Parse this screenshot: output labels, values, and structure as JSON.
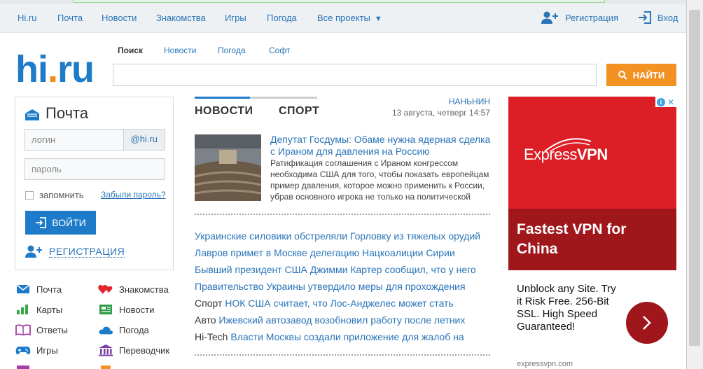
{
  "topnav": {
    "items": [
      "Hi.ru",
      "Почта",
      "Новости",
      "Знакомства",
      "Игры",
      "Погода",
      "Все проекты"
    ],
    "register": "Регистрация",
    "login": "Вход"
  },
  "logo": {
    "part1": "hi",
    "dot": ".",
    "part2": "ru"
  },
  "search": {
    "tabs": [
      "Поиск",
      "Новости",
      "Погода",
      "Софт"
    ],
    "button": "НАЙТИ",
    "placeholder": ""
  },
  "mail": {
    "title": "Почта",
    "login_placeholder": "логин",
    "domain": "@hi.ru",
    "password_placeholder": "пароль",
    "remember": "запомнить",
    "forgot": "Забыли пароль?",
    "login_button": "ВОЙТИ",
    "register": "РЕГИСТРАЦИЯ"
  },
  "services": [
    {
      "label": "Почта",
      "icon": "envelope-icon"
    },
    {
      "label": "Знакомства",
      "icon": "hearts-icon"
    },
    {
      "label": "Карты",
      "icon": "map-icon"
    },
    {
      "label": "Новости",
      "icon": "newspaper-icon"
    },
    {
      "label": "Ответы",
      "icon": "book-icon"
    },
    {
      "label": "Погода",
      "icon": "cloud-icon"
    },
    {
      "label": "Игры",
      "icon": "gamepad-icon"
    },
    {
      "label": "Переводчик",
      "icon": "building-icon"
    }
  ],
  "news": {
    "tabs": [
      "НОВОСТИ",
      "СПОРТ"
    ],
    "city": "НАНЬНИН",
    "date": "13 августа, четверг 14:57",
    "top": {
      "headline": "Депутат Госдумы: Обаме нужна ядерная сделка с Ираном для давления на Россию",
      "lead": "Ратификация соглашения с Ираном конгрессом необходима США для того, чтобы показать европейцам пример давления, которое можно применить к России, убрав основного игрока не только на политической"
    },
    "items": [
      {
        "cat": "",
        "text": "Украинские силовики обстреляли Горловку из тяжелых орудий"
      },
      {
        "cat": "",
        "text": "Лавров примет в Москве делегацию Нацкоалиции Сирии"
      },
      {
        "cat": "",
        "text": "Бывший президент США Джимми Картер сообщил, что у него"
      },
      {
        "cat": "",
        "text": "Правительство Украины утвердило меры для прохождения"
      },
      {
        "cat": "Спорт",
        "text": "НОК США считает, что Лос-Анджелес может стать"
      },
      {
        "cat": "Авто",
        "text": "Ижевский автозавод возобновил работу после летних"
      },
      {
        "cat": "Hi-Tech",
        "text": "Власти Москвы создали приложение для жалоб на"
      }
    ]
  },
  "ad": {
    "logo_light": "Express",
    "logo_bold": "VPN",
    "headline": "Fastest VPN for China",
    "text": "Unblock any Site. Try it Risk Free. 256-Bit SSL. High Speed Guaranteed!",
    "url": "expressvpn.com",
    "colors": {
      "red": "#dc1f26",
      "dark": "#a0171b"
    }
  }
}
